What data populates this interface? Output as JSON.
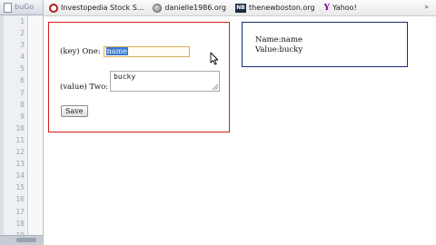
{
  "editor": {
    "tab_text": "buGo",
    "line_numbers": [
      "1",
      "2",
      "3",
      "4",
      "5",
      "6",
      "7",
      "8",
      "9",
      "10",
      "11",
      "12",
      "13",
      "14",
      "15",
      "16",
      "17",
      "18",
      "19"
    ]
  },
  "bookmarks": [
    {
      "label": "Investopedia Stock S...",
      "icon": "investopedia-icon"
    },
    {
      "label": "danielle1986.org",
      "icon": "globe-icon"
    },
    {
      "label": "thenewboston.org",
      "icon": "newboston-icon",
      "icon_text": "NB"
    },
    {
      "label": "Yahoo!",
      "icon": "yahoo-icon",
      "icon_text": "Y"
    }
  ],
  "bookmarks_overflow": "»",
  "form": {
    "one_label": "(key) One:",
    "one_value": "name",
    "two_label": "(value) Two:",
    "two_value": "bucky",
    "save_label": "Save"
  },
  "result": {
    "line1": "Name:name",
    "line2": "Value:bucky"
  },
  "colors": {
    "form_border": "#d21c1c",
    "result_border": "#1a2a7a",
    "selection": "#3a78d2"
  }
}
